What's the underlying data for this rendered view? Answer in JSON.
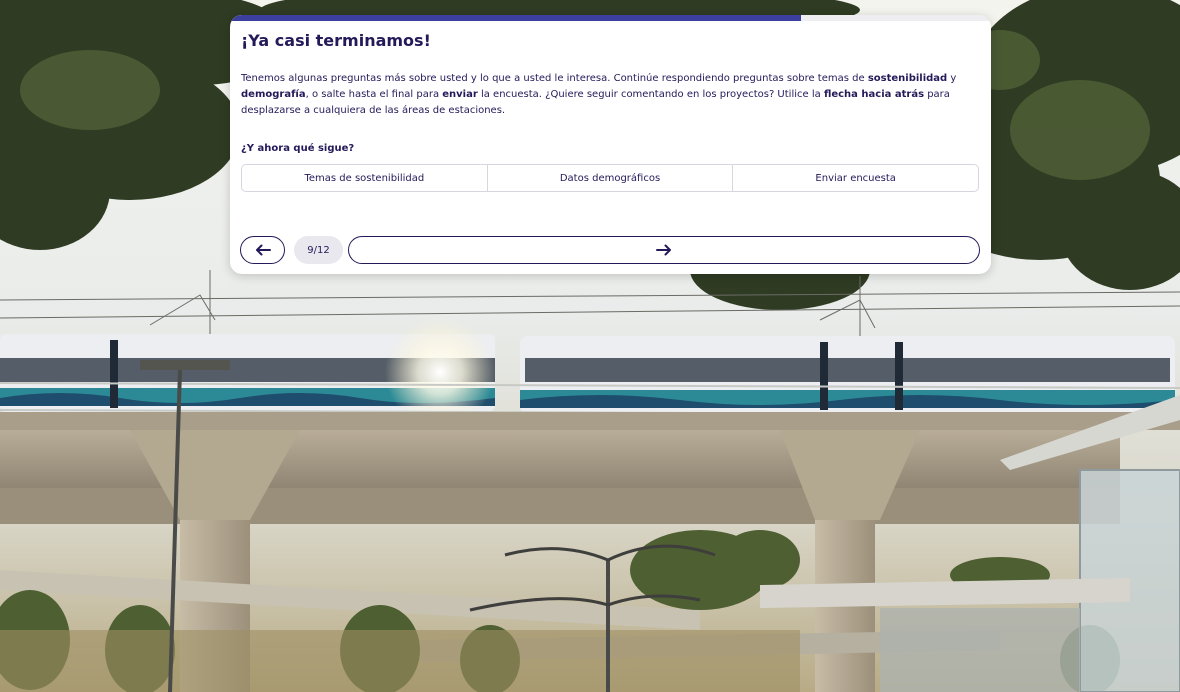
{
  "survey": {
    "title": "¡Ya casi terminamos!",
    "body": {
      "p1": "Tenemos algunas preguntas más sobre usted y lo que a usted le interesa. Continúe respondiendo preguntas sobre temas de ",
      "b1": "sostenibilidad",
      "p2": " y ",
      "b2": "demografía",
      "p3": ", o salte hasta el final para ",
      "b3": "enviar",
      "p4": " la encuesta. ¿Quiere seguir comentando en los proyectos? Utilice la ",
      "b4": "flecha hacia atrás",
      "p5": " para desplazarse a cualquiera de las áreas de estaciones."
    },
    "next_heading": "¿Y ahora qué sigue?",
    "steps": [
      "Temas de sostenibilidad",
      "Datos demográficos",
      "Enviar encuesta"
    ],
    "progress": {
      "label": "9/12",
      "current": 9,
      "total": 12
    },
    "back_icon": "arrow-left-icon",
    "next_icon": "arrow-right-icon",
    "accent_color": "#3d3f9e",
    "text_color": "#241a59"
  }
}
